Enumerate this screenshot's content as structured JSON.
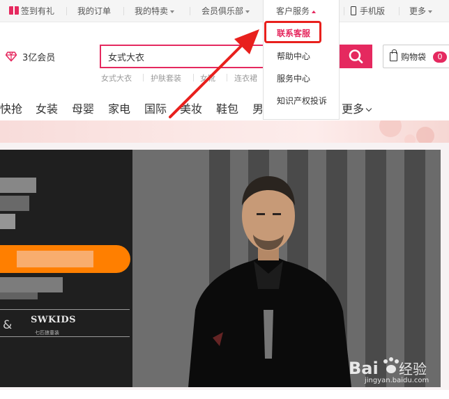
{
  "topbar": {
    "checkin": "签到有礼",
    "orders": "我的订单",
    "specials": "我的特卖",
    "club": "会员俱乐部",
    "service": "客户服务",
    "mobile": "手机版",
    "more": "更多"
  },
  "service_menu": {
    "items": [
      "联系客服",
      "帮助中心",
      "服务中心",
      "知识产权投诉"
    ],
    "highlighted": "联系客服"
  },
  "header": {
    "member_count": "3亿会员",
    "search_value": "女式大衣",
    "hot_keywords": [
      "女式大衣",
      "护肤套装",
      "女靴",
      "连衣裙"
    ],
    "cart_label": "购物袋",
    "cart_count": "0"
  },
  "nav": {
    "categories": [
      "快抢",
      "女装",
      "母婴",
      "家电",
      "国际",
      "美妆",
      "鞋包",
      "男"
    ],
    "more": "更多"
  },
  "hero": {
    "brand": "SWKIDS",
    "brand_sub": "七匹狼童装",
    "amp": "&"
  },
  "watermark": {
    "site": "jingyan.baidu.com"
  },
  "colors": {
    "accent": "#e5295f",
    "highlight_box": "#e8201d",
    "promo_pill": "#ff7f00"
  }
}
